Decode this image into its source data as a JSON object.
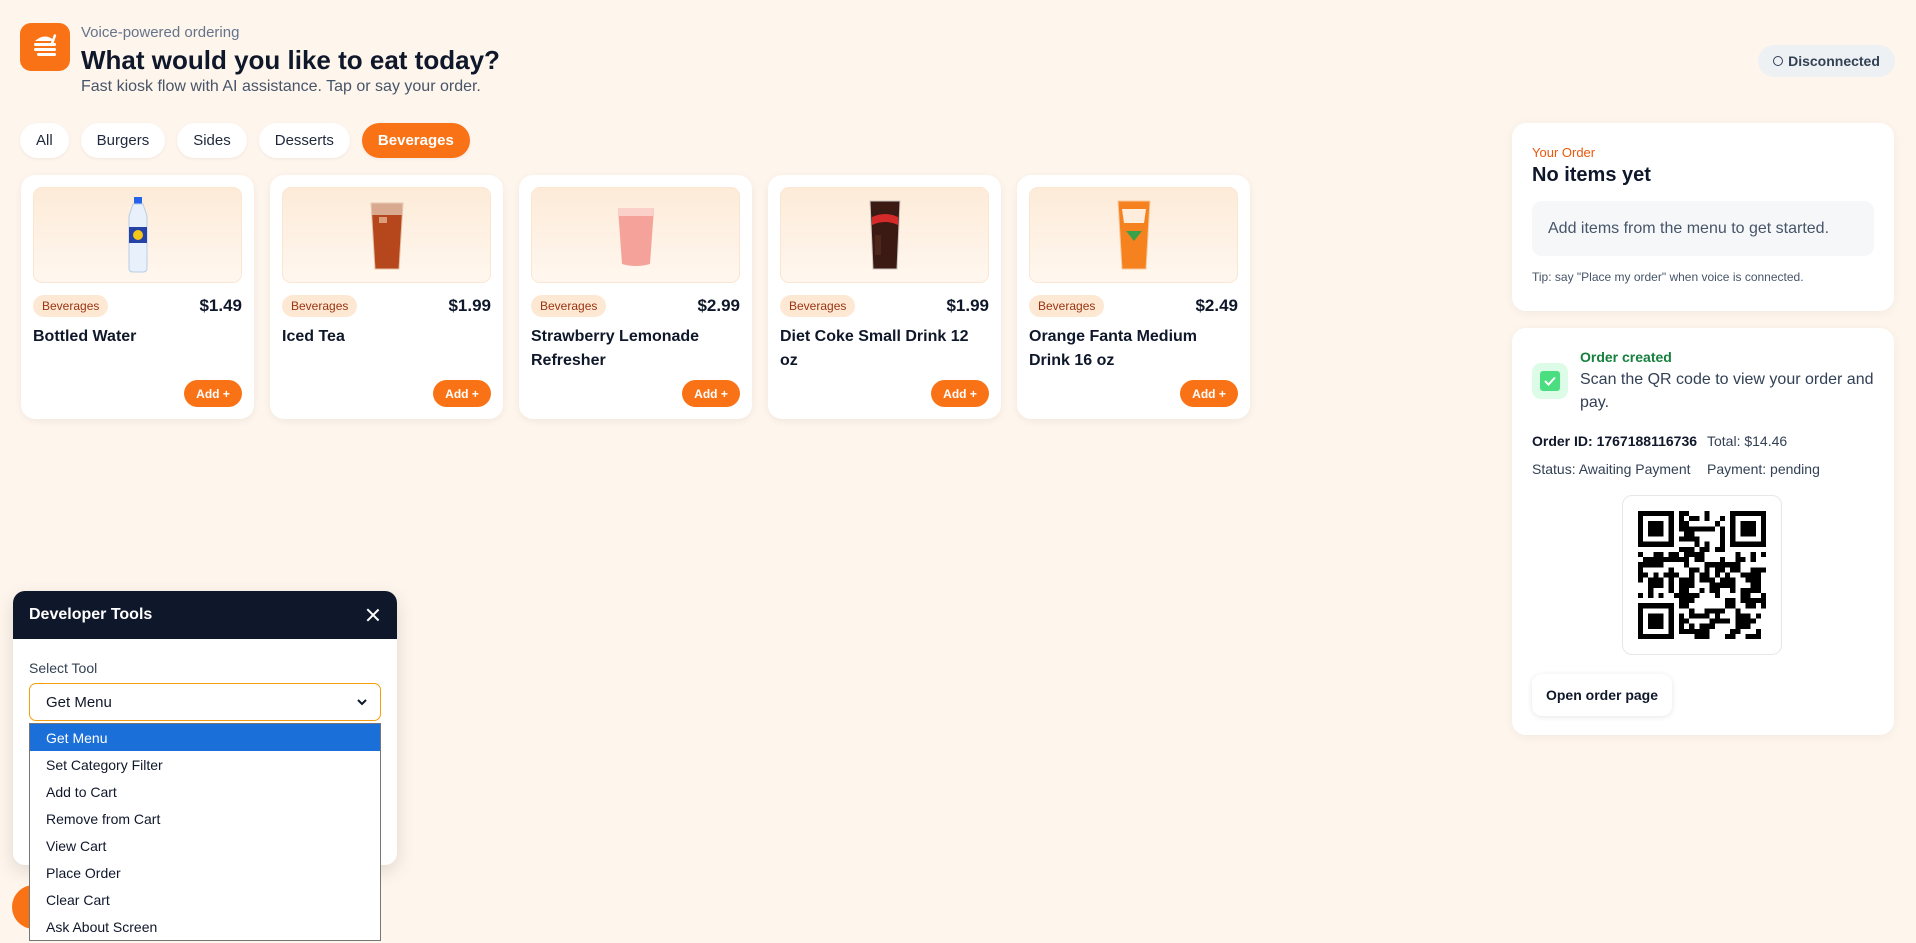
{
  "header": {
    "subtitle": "Voice-powered ordering",
    "title": "What would you like to eat today?",
    "description": "Fast kiosk flow with AI assistance. Tap or say your order.",
    "connection_status": "Disconnected"
  },
  "categories": [
    {
      "label": "All",
      "active": false
    },
    {
      "label": "Burgers",
      "active": false
    },
    {
      "label": "Sides",
      "active": false
    },
    {
      "label": "Desserts",
      "active": false
    },
    {
      "label": "Beverages",
      "active": true
    }
  ],
  "menu_items": [
    {
      "category": "Beverages",
      "price": "$1.49",
      "name": "Bottled Water",
      "add_label": "Add +",
      "icon": "water-bottle-icon"
    },
    {
      "category": "Beverages",
      "price": "$1.99",
      "name": "Iced Tea",
      "add_label": "Add +",
      "icon": "iced-tea-glass-icon"
    },
    {
      "category": "Beverages",
      "price": "$2.99",
      "name": "Strawberry Lemonade Refresher",
      "add_label": "Add +",
      "icon": "lemonade-cup-icon"
    },
    {
      "category": "Beverages",
      "price": "$1.99",
      "name": "Diet Coke Small Drink 12 oz",
      "add_label": "Add +",
      "icon": "cola-glass-icon"
    },
    {
      "category": "Beverages",
      "price": "$2.49",
      "name": "Orange Fanta Medium Drink 16 oz",
      "add_label": "Add +",
      "icon": "orange-soda-glass-icon"
    }
  ],
  "order": {
    "kicker": "Your Order",
    "heading": "No items yet",
    "empty_message": "Add items from the menu to get started.",
    "tip": "Tip: say \"Place my order\" when voice is connected."
  },
  "order_created": {
    "kicker": "Order created",
    "message": "Scan the QR code to view your order and pay.",
    "order_id_label": "Order ID:",
    "order_id": "1767188116736",
    "total_label": "Total:",
    "total": "$14.46",
    "status_label": "Status:",
    "status": "Awaiting Payment",
    "payment_label": "Payment:",
    "payment": "pending",
    "open_button": "Open order page"
  },
  "dev_tools": {
    "title": "Developer Tools",
    "select_label": "Select Tool",
    "selected": "Get Menu",
    "options": [
      "Get Menu",
      "Set Category Filter",
      "Add to Cart",
      "Remove from Cart",
      "View Cart",
      "Place Order",
      "Clear Cart",
      "Ask About Screen"
    ]
  },
  "colors": {
    "accent": "#f97316",
    "background": "#fef5ec",
    "success": "#15803d",
    "selection": "#1a6fd8"
  }
}
